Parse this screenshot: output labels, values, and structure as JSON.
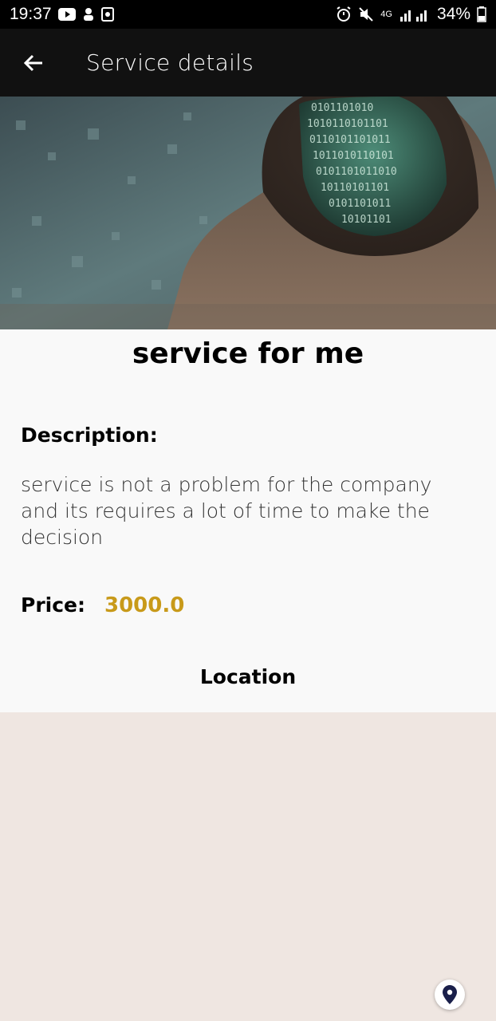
{
  "status_bar": {
    "time": "19:37",
    "battery": "34%",
    "network": "4G",
    "icons": [
      "youtube-icon",
      "notification-icon",
      "screenshot-icon",
      "alarm-icon",
      "mute-icon",
      "signal-icon",
      "battery-icon"
    ]
  },
  "app_bar": {
    "title": "Service details",
    "back_icon": "arrow-left-icon"
  },
  "hero_image": {
    "subject": "hooded-figure-binary-code"
  },
  "service": {
    "title": "service for me",
    "description_label": "Description:",
    "description": "service is not a problem for the company and its requires a lot of time to make the decision",
    "price_label": "Price:",
    "price_value": "3000.0",
    "location_label": "Location"
  },
  "colors": {
    "app_bar": "#111111",
    "price": "#c89a1a",
    "map_background": "#efe6e1",
    "pin": "#1a1f4a"
  }
}
